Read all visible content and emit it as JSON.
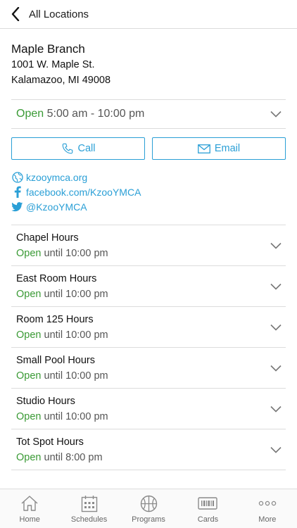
{
  "header": {
    "title": "All Locations"
  },
  "branch": {
    "name": "Maple Branch",
    "address_line1": "1001 W. Maple St.",
    "address_line2": "Kalamazoo, MI 49008"
  },
  "hours": {
    "status": "Open",
    "range": "5:00 am - 10:00 pm"
  },
  "actions": {
    "call_label": "Call",
    "email_label": "Email"
  },
  "links": {
    "website": "kzooymca.org",
    "facebook": "facebook.com/KzooYMCA",
    "twitter": "@KzooYMCA"
  },
  "facilities": [
    {
      "name": "Chapel Hours",
      "status": "Open",
      "until": "until 10:00 pm"
    },
    {
      "name": "East Room Hours",
      "status": "Open",
      "until": "until 10:00 pm"
    },
    {
      "name": "Room 125 Hours",
      "status": "Open",
      "until": "until 10:00 pm"
    },
    {
      "name": "Small Pool Hours",
      "status": "Open",
      "until": "until 10:00 pm"
    },
    {
      "name": "Studio Hours",
      "status": "Open",
      "until": "until 10:00 pm"
    },
    {
      "name": "Tot Spot Hours",
      "status": "Open",
      "until": "until 8:00 pm"
    }
  ],
  "tabs": [
    {
      "label": "Home",
      "icon": "home-icon"
    },
    {
      "label": "Schedules",
      "icon": "calendar-icon"
    },
    {
      "label": "Programs",
      "icon": "basketball-icon"
    },
    {
      "label": "Cards",
      "icon": "barcode-card-icon"
    },
    {
      "label": "More",
      "icon": "more-dots-icon"
    }
  ],
  "colors": {
    "accent": "#2a9fd6",
    "open_green": "#3a9a35",
    "divider": "#dcdcdc"
  }
}
